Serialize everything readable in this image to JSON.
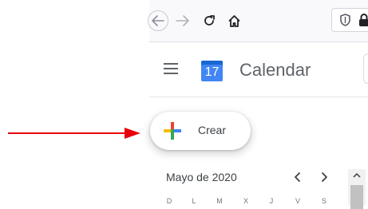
{
  "browser": {
    "icons": [
      "back-arrow-icon",
      "forward-arrow-icon",
      "reload-icon",
      "home-icon",
      "shield-icon",
      "lock-icon"
    ]
  },
  "header": {
    "calendar_day": "17",
    "app_name": "Calendar"
  },
  "create_button": {
    "label": "Crear"
  },
  "mini_calendar": {
    "month": "Mayo de 2020",
    "weekdays": [
      "D",
      "L",
      "M",
      "X",
      "J",
      "V",
      "S"
    ]
  },
  "colors": {
    "annotation_arrow": "#e8000b",
    "calendar_blue": "#4285f4",
    "plus_red": "#ea4335",
    "plus_yellow": "#fbbc04",
    "plus_green": "#34a853",
    "plus_blue": "#4285f4"
  }
}
